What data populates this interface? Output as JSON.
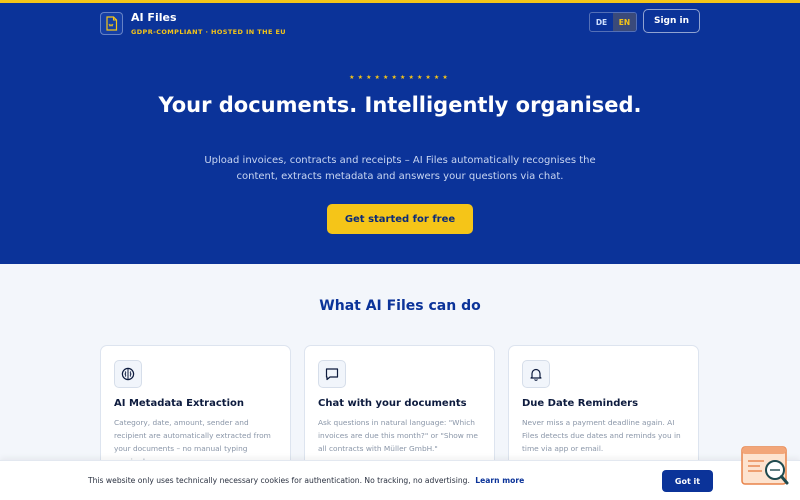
{
  "brand": {
    "name": "AI Files",
    "tagline": "GDPR-COMPLIANT · HOSTED IN THE EU"
  },
  "nav": {
    "languages": [
      "DE",
      "EN"
    ],
    "active_language": "EN",
    "signin_label": "Sign in"
  },
  "hero": {
    "stars": "★★★★★★★★★★★★",
    "title": "Your documents. Intelligently organised.",
    "subtitle": "Upload invoices, contracts and receipts – AI Files automatically recognises the content, extracts metadata and answers your questions via chat.",
    "cta_label": "Get started for free"
  },
  "features": {
    "title": "What AI Files can do",
    "items": [
      {
        "icon": "brain-icon",
        "title": "AI Metadata Extraction",
        "description": "Category, date, amount, sender and recipient are automatically extracted from your documents – no manual typing required."
      },
      {
        "icon": "chat-icon",
        "title": "Chat with your documents",
        "description": "Ask questions in natural language: \"Which invoices are due this month?\" or \"Show me all contracts with Müller GmbH.\""
      },
      {
        "icon": "bell-icon",
        "title": "Due Date Reminders",
        "description": "Never miss a payment deadline again. AI Files detects due dates and reminds you in time via app or email."
      }
    ]
  },
  "cookie": {
    "text": "This website only uses technically necessary cookies for authentication. No tracking, no advertising.",
    "link_label": "Learn more",
    "button_label": "Got it"
  },
  "colors": {
    "primary": "#0b3399",
    "accent": "#f5c518",
    "page_bg": "#f3f6fb"
  }
}
